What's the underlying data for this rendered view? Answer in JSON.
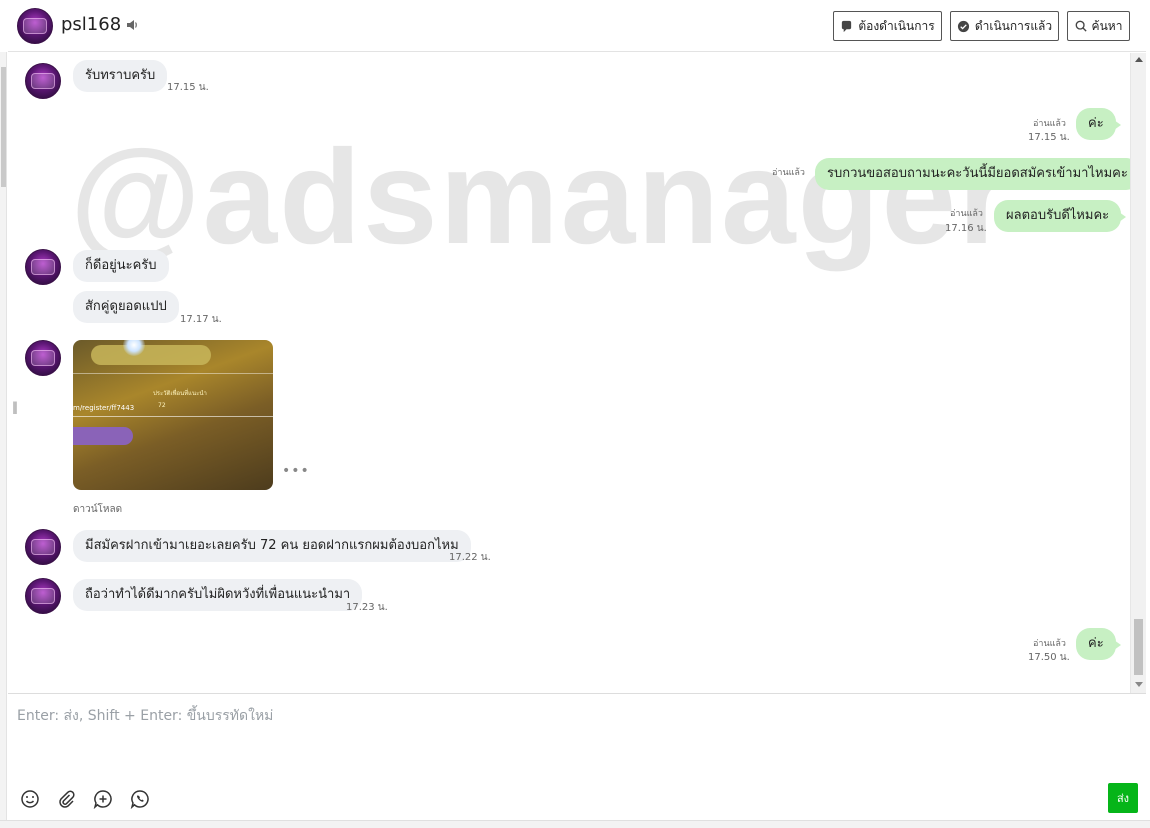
{
  "header": {
    "chat_name": "psl168",
    "buttons": {
      "todo": "ต้องดำเนินการ",
      "done": "ดำเนินการแล้ว",
      "search": "ค้นหา"
    }
  },
  "watermark": "@adsmanager",
  "messages": {
    "m1": {
      "text": "รับทราบครับ",
      "time": "17.15 น."
    },
    "m2": {
      "text": "ค่ะ",
      "read": "อ่านแล้ว",
      "time": "17.15 น."
    },
    "m3": {
      "text": "รบกวนขอสอบถามนะคะวันนี้มียอดสมัครเข้ามาไหมคะ",
      "read": "อ่านแล้ว"
    },
    "m4": {
      "text": "ผลตอบรับดีไหมคะ",
      "read": "อ่านแล้ว",
      "time": "17.16 น."
    },
    "m5": {
      "text": "ก็ดีอยู่นะครับ"
    },
    "m6": {
      "text": "สักคู่ดูยอดแปป",
      "time": "17.17 น."
    },
    "image": {
      "line1": "ประวัติเพื่อนที่แนะนำ",
      "line2": "72",
      "line3": "m/register/ff7443",
      "download": "ดาวน์โหลด"
    },
    "m7": {
      "text": "มีสมัครฝากเข้ามาเยอะเลยครับ 72 คน ยอดฝากแรกผมต้องบอกไหม",
      "time": "17.22 น."
    },
    "m8": {
      "text": "ถือว่าทำได้ดีมากครับไม่ผิดหวังที่เพื่อนแนะนำมา",
      "time": "17.23 น."
    },
    "m9": {
      "text": "ค่ะ",
      "read": "อ่านแล้ว",
      "time": "17.50 น."
    }
  },
  "composer": {
    "placeholder": "Enter: ส่ง, Shift + Enter: ขึ้นบรรทัดใหม่",
    "send_label": "ส่ง"
  },
  "icons": [
    "speaker-icon",
    "todo-icon",
    "done-icon",
    "search-icon",
    "emoji-icon",
    "attach-icon",
    "add-icon",
    "call-icon"
  ],
  "colors": {
    "outgoing_bubble": "#c7f0c3",
    "incoming_bubble": "#eef0f3",
    "send_button": "#06b519"
  }
}
